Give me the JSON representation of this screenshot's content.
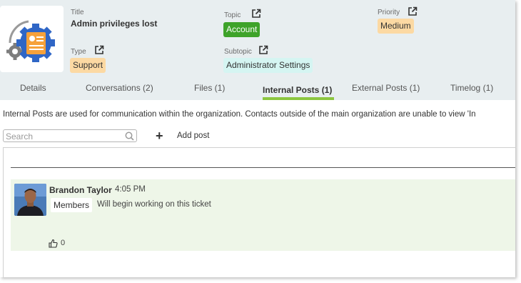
{
  "ticket": {
    "title_label": "Title",
    "title": "Admin privileges lost",
    "topic_label": "Topic",
    "topic": "Account",
    "priority_label": "Priority",
    "priority": "Medium",
    "type_label": "Type",
    "type": "Support",
    "subtopic_label": "Subtopic",
    "subtopic": "Administrator Settings"
  },
  "colors": {
    "topic_chip": "#3ea32a",
    "priority_chip": "#fcd9a3",
    "type_chip": "#fcd9a3",
    "subtopic_chip": "#d5f5f2",
    "active_tab_underline": "#8cc63f",
    "post_background": "#eef6e8"
  },
  "tabs": [
    {
      "label": "Details"
    },
    {
      "label": "Conversations (2)"
    },
    {
      "label": "Files (1)"
    },
    {
      "label": "Internal Posts (1)",
      "active": true
    },
    {
      "label": "External Posts (1)"
    },
    {
      "label": "Timelog (1)"
    }
  ],
  "info_text": "Internal Posts are used for communication within the organization. Contacts outside of the main organization are unable to view 'In",
  "search": {
    "placeholder": "Search"
  },
  "add_post_label": "Add post",
  "posts": [
    {
      "author": "Brandon Taylor",
      "time": "4:05 PM",
      "audience": "Members",
      "text": "Will begin working on this ticket",
      "likes": "0"
    }
  ],
  "icons": {
    "ticket_logo": "gear-document-icon",
    "external_link": "external-link-icon",
    "search": "search-icon",
    "add": "plus-icon",
    "like": "thumbs-up-icon"
  }
}
